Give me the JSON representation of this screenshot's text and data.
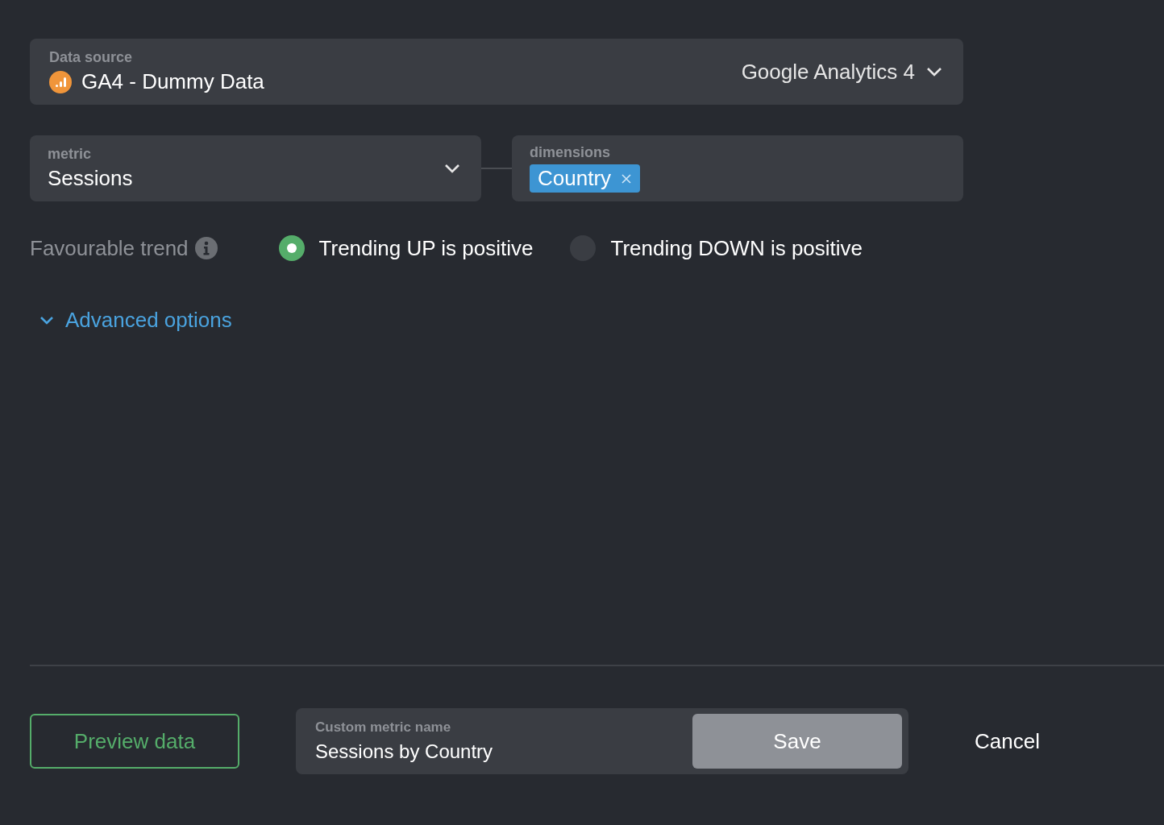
{
  "data_source": {
    "label": "Data source",
    "value": "GA4 - Dummy Data",
    "provider": "Google Analytics 4"
  },
  "metric": {
    "label": "metric",
    "value": "Sessions"
  },
  "dimensions": {
    "label": "dimensions",
    "chips": [
      {
        "label": "Country"
      }
    ]
  },
  "trend": {
    "label": "Favourable trend",
    "options": [
      {
        "label": "Trending UP is positive",
        "selected": true
      },
      {
        "label": "Trending DOWN is positive",
        "selected": false
      }
    ]
  },
  "advanced": {
    "label": "Advanced options"
  },
  "preview_button": "Preview data",
  "custom_name": {
    "label": "Custom metric name",
    "value": "Sessions by Country"
  },
  "save": {
    "label": "Save",
    "disabled": true
  },
  "cancel": "Cancel"
}
